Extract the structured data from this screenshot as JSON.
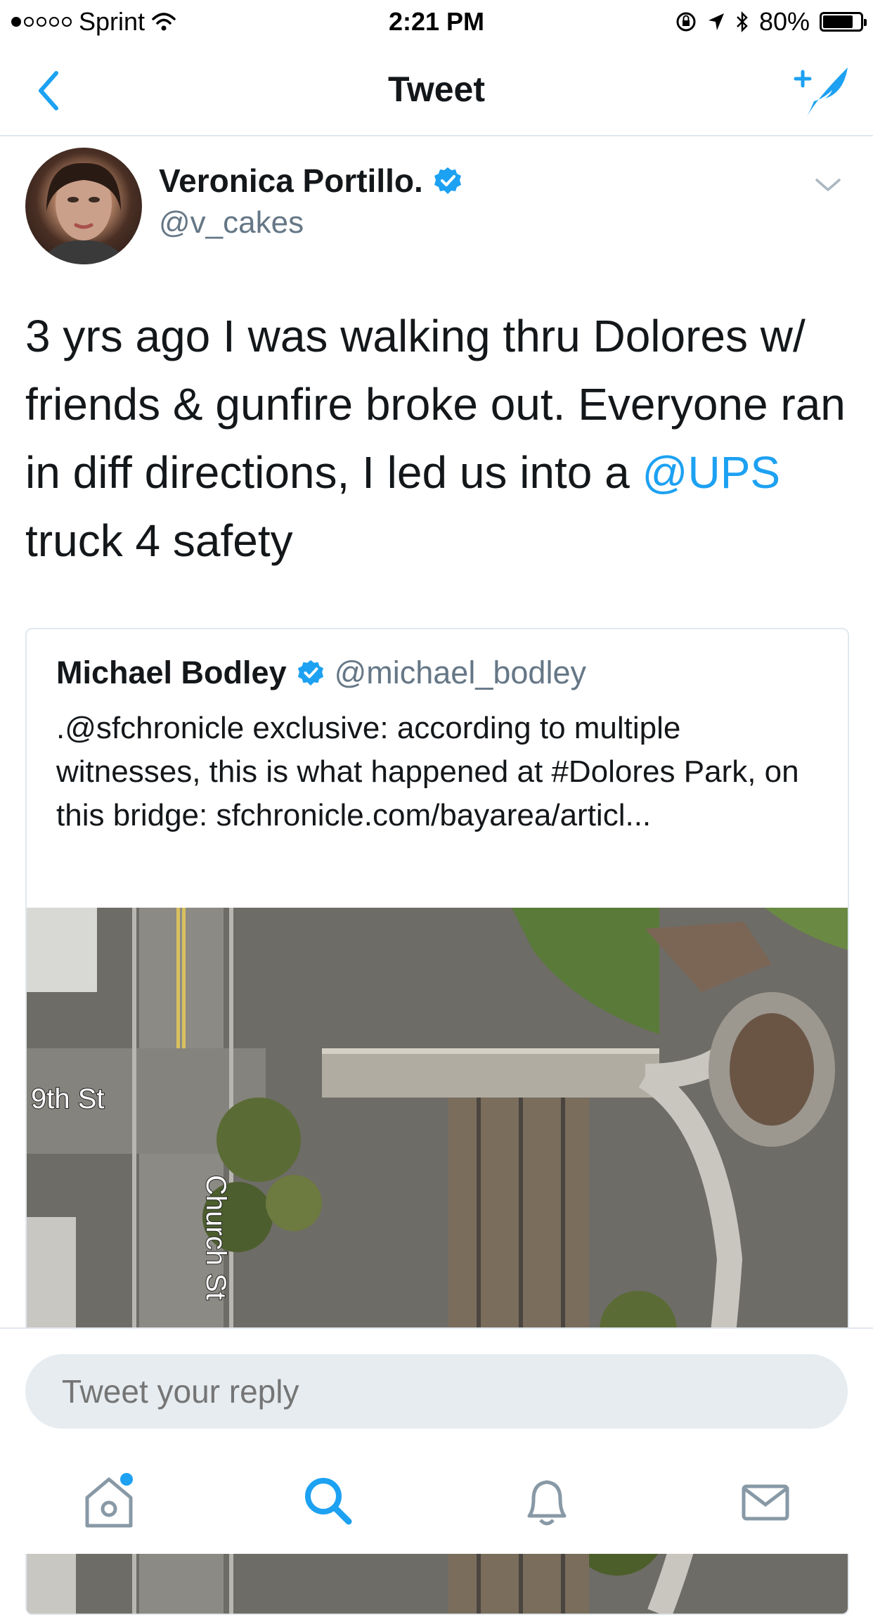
{
  "status_bar": {
    "carrier": "Sprint",
    "time": "2:21 PM",
    "battery": "80%",
    "battery_level": 0.8
  },
  "nav": {
    "title": "Tweet",
    "back_icon": "chevron-left-icon",
    "compose_icon": "compose-tweet-icon"
  },
  "tweet": {
    "author_name": "Veronica Portillo.",
    "author_handle": "@v_cakes",
    "verified": true,
    "text_before": "3 yrs ago I was walking thru Dolores w/ friends & gunfire broke out. Everyone ran in diff directions, I led us into a ",
    "mention": "@UPS",
    "text_after": " truck 4 safety"
  },
  "quoted_tweet": {
    "author_name": "Michael Bodley",
    "author_handle": "@michael_bodley",
    "verified": true,
    "text": ".@sfchronicle exclusive: according to multiple witnesses, this is what happened at #Dolores Park, on this bridge: sfchronicle.com/bayarea/articl...",
    "image_labels": {
      "street_1": "9th St",
      "street_2": "Church St"
    }
  },
  "reply": {
    "placeholder": "Tweet your reply"
  },
  "tabs": [
    {
      "name": "home",
      "icon": "home-icon",
      "has_notification_dot": true
    },
    {
      "name": "search",
      "icon": "search-icon",
      "active": true
    },
    {
      "name": "notifications",
      "icon": "bell-icon"
    },
    {
      "name": "messages",
      "icon": "envelope-icon"
    }
  ],
  "colors": {
    "accent": "#1da1f2",
    "text": "#14171a",
    "secondary_text": "#657786",
    "divider": "#e1e8ed",
    "reply_bg": "#e6ecf0"
  }
}
